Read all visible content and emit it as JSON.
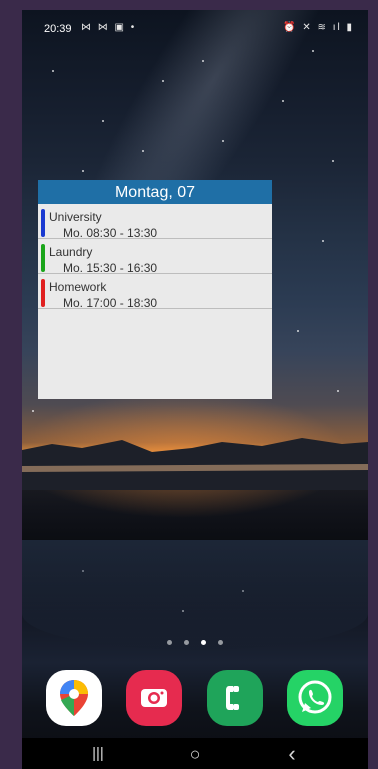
{
  "status_bar": {
    "time": "20:39",
    "left_icons": "⋈ ⋈ ▣ •",
    "right_icons": "⏰ ✕ ≋ ıl ▮"
  },
  "widget": {
    "header": "Montag, 07",
    "events": [
      {
        "title": "University",
        "time": "Mo. 08:30 - 13:30",
        "color": "#1a3ad1"
      },
      {
        "title": "Laundry",
        "time": "Mo. 15:30 - 16:30",
        "color": "#1aa51a"
      },
      {
        "title": "Homework",
        "time": "Mo. 17:00 - 18:30",
        "color": "#e02020"
      }
    ]
  },
  "home": {
    "page_count": 4,
    "active_page": 3
  },
  "dock": {
    "apps": [
      {
        "icon": "google-maps-icon",
        "color": "#ffffff"
      },
      {
        "icon": "camera-icon",
        "color": "#e62b4f"
      },
      {
        "icon": "phone-icon",
        "color": "#1fa45a"
      },
      {
        "icon": "whatsapp-icon",
        "color": "#25d366"
      }
    ]
  },
  "nav_bar": {
    "recents": "|||",
    "home": "○",
    "back": "‹"
  }
}
